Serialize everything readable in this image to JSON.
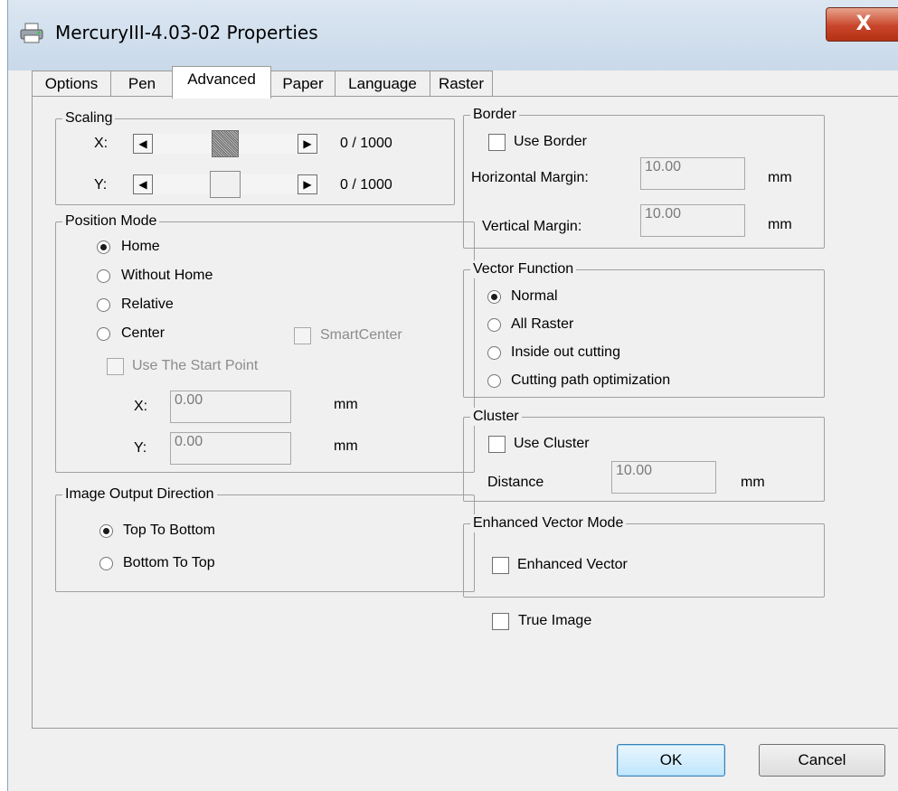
{
  "window": {
    "title": "MercuryIII-4.03-02 Properties",
    "close_label": "X"
  },
  "tabs": [
    "Options",
    "Pen",
    "Advanced",
    "Paper",
    "Language",
    "Raster"
  ],
  "active_tab": "Advanced",
  "scaling": {
    "legend": "Scaling",
    "x_label": "X:",
    "x_value": "0 / 1000",
    "y_label": "Y:",
    "y_value": "0 / 1000"
  },
  "position_mode": {
    "legend": "Position Mode",
    "options": [
      "Home",
      "Without Home",
      "Relative",
      "Center"
    ],
    "selected": "Home",
    "smart_center": "SmartCenter",
    "use_start_point": "Use The Start Point",
    "x_label": "X:",
    "x_value": "0.00",
    "y_label": "Y:",
    "y_value": "0.00",
    "unit": "mm"
  },
  "image_output": {
    "legend": "Image Output Direction",
    "options": [
      "Top To Bottom",
      "Bottom To Top"
    ],
    "selected": "Top To Bottom"
  },
  "border": {
    "legend": "Border",
    "use_border": "Use Border",
    "horizontal_label": "Horizontal Margin:",
    "horizontal_value": "10.00",
    "vertical_label": "Vertical Margin:",
    "vertical_value": "10.00",
    "unit": "mm"
  },
  "vector_function": {
    "legend": "Vector Function",
    "options": [
      "Normal",
      "All Raster",
      "Inside out cutting",
      "Cutting path optimization"
    ],
    "selected": "Normal"
  },
  "cluster": {
    "legend": "Cluster",
    "use_cluster": "Use Cluster",
    "distance_label": "Distance",
    "distance_value": "10.00",
    "unit": "mm"
  },
  "enhanced": {
    "legend": "Enhanced Vector Mode",
    "checkbox": "Enhanced Vector"
  },
  "true_image": "True Image",
  "buttons": {
    "ok": "OK",
    "cancel": "Cancel"
  },
  "colors": {
    "dialog_bg": "#f0f0f0",
    "close_button": "#c8452b",
    "ok_button": "#bee6fd"
  }
}
